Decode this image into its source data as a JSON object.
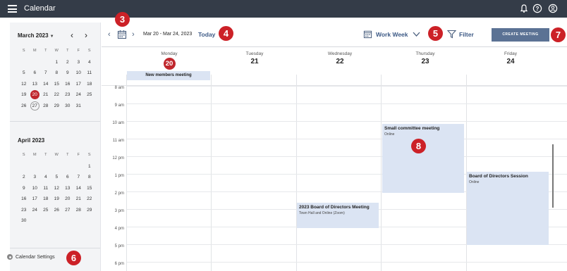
{
  "app": {
    "title": "Calendar"
  },
  "sidebar": {
    "march": {
      "title": "March 2023",
      "dow": [
        "S",
        "M",
        "T",
        "W",
        "T",
        "F",
        "S"
      ],
      "weeks": [
        [
          "",
          "",
          "",
          "1",
          "2",
          "3",
          "4"
        ],
        [
          "5",
          "6",
          "7",
          "8",
          "9",
          "10",
          "11"
        ],
        [
          "12",
          "13",
          "14",
          "15",
          "16",
          "17",
          "18"
        ],
        [
          "19",
          "20",
          "21",
          "22",
          "23",
          "24",
          "25"
        ],
        [
          "26",
          "27",
          "28",
          "29",
          "30",
          "31",
          ""
        ]
      ],
      "today": "20",
      "selected": "27"
    },
    "april": {
      "title": "April 2023",
      "dow": [
        "S",
        "M",
        "T",
        "W",
        "T",
        "F",
        "S"
      ],
      "weeks": [
        [
          "",
          "",
          "",
          "",
          "",
          "",
          "1"
        ],
        [
          "2",
          "3",
          "4",
          "5",
          "6",
          "7",
          "8"
        ],
        [
          "9",
          "10",
          "11",
          "12",
          "13",
          "14",
          "15"
        ],
        [
          "16",
          "17",
          "18",
          "19",
          "20",
          "21",
          "22"
        ],
        [
          "23",
          "24",
          "25",
          "26",
          "27",
          "28",
          "29"
        ],
        [
          "30",
          "",
          "",
          "",
          "",
          "",
          ""
        ]
      ]
    },
    "settings_label": "Calendar Settings"
  },
  "toolbar": {
    "date_range": "Mar 20 - Mar 24, 2023",
    "today_label": "Today",
    "view_label": "Work Week",
    "filter_label": "Filter",
    "create_label": "CREATE MEETING"
  },
  "badges": [
    "3",
    "4",
    "5",
    "6",
    "7",
    "8"
  ],
  "days": [
    {
      "name": "Monday",
      "num": "20",
      "today": true
    },
    {
      "name": "Tuesday",
      "num": "21",
      "today": false
    },
    {
      "name": "Wednesday",
      "num": "22",
      "today": false
    },
    {
      "name": "Thursday",
      "num": "23",
      "today": false
    },
    {
      "name": "Friday",
      "num": "24",
      "today": false
    }
  ],
  "hours": [
    "8 am",
    "9 am",
    "10 am",
    "11 am",
    "12 pm",
    "1 pm",
    "2 pm",
    "3 pm",
    "4 pm",
    "5 pm",
    "6 pm"
  ],
  "events": {
    "allday": {
      "title": "New members meeting"
    },
    "small_committee": {
      "title": "Small committee meeting",
      "location": "Online"
    },
    "board_directors": {
      "title": "2023 Board of Directors Meeting",
      "location": "Town Hall and Online (Zoom)"
    },
    "board_session": {
      "title": "Board of Directors Session",
      "location": "Online"
    }
  },
  "colors": {
    "topbar": "#343c48",
    "accent": "#c0272d",
    "event": "#dbe4f3",
    "primary_button": "#5b7294",
    "link": "#3d5a86"
  }
}
